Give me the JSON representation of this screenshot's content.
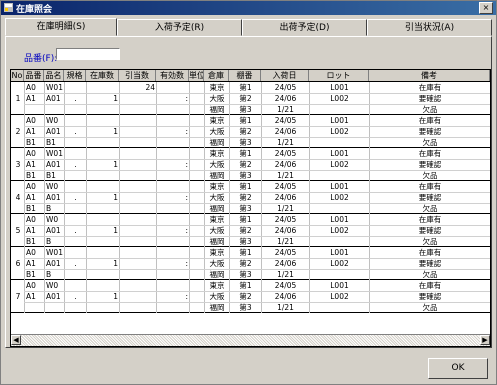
{
  "window": {
    "title": "在庫照会"
  },
  "tabs": [
    {
      "label": "在庫明細(S)"
    },
    {
      "label": "入荷予定(R)"
    },
    {
      "label": "出荷予定(D)"
    },
    {
      "label": "引当状況(A)"
    }
  ],
  "filter": {
    "label": "品番(F):",
    "value": ""
  },
  "columns": [
    "No",
    "品番",
    "品名",
    "規格",
    "在庫数",
    "引当数",
    "有効数",
    "単位",
    "倉庫",
    "棚番",
    "入荷日",
    "ロット",
    "備考"
  ],
  "records": [
    {
      "no": "1",
      "code": [
        "A0",
        "A1",
        ""
      ],
      "name": [
        "W01",
        "A01",
        ""
      ],
      "spec": ".",
      "stock": "1",
      "alloc": "24",
      "avail": ":",
      "unit": "",
      "wh": [
        "東京",
        "大阪",
        "福岡"
      ],
      "shelf": [
        "第1",
        "第2",
        "第3"
      ],
      "date": [
        "24/05",
        "24/06",
        "1/21"
      ],
      "lot": [
        "L001",
        "L002",
        ""
      ],
      "note": [
        "在庫有",
        "要確認",
        "欠品"
      ]
    },
    {
      "no": "2",
      "code": [
        "A0",
        "A1",
        "B1"
      ],
      "name": [
        "W0",
        "A01",
        "B1"
      ],
      "spec": ".",
      "stock": "1",
      "alloc": "",
      "avail": ":",
      "unit": "",
      "wh": [
        "東京",
        "大阪",
        "福岡"
      ],
      "shelf": [
        "第1",
        "第2",
        "第3"
      ],
      "date": [
        "24/05",
        "24/06",
        "1/21"
      ],
      "lot": [
        "L001",
        "L002",
        ""
      ],
      "note": [
        "在庫有",
        "要確認",
        "欠品"
      ]
    },
    {
      "no": "3",
      "code": [
        "A0",
        "A1",
        "B1"
      ],
      "name": [
        "W01",
        "A01",
        "B1"
      ],
      "spec": ".",
      "stock": "1",
      "alloc": "",
      "avail": ":",
      "unit": "",
      "wh": [
        "東京",
        "大阪",
        "福岡"
      ],
      "shelf": [
        "第1",
        "第2",
        "第3"
      ],
      "date": [
        "24/05",
        "24/06",
        "1/21"
      ],
      "lot": [
        "L001",
        "L002",
        ""
      ],
      "note": [
        "在庫有",
        "要確認",
        "欠品"
      ]
    },
    {
      "no": "4",
      "code": [
        "A0",
        "A1",
        "B1"
      ],
      "name": [
        "W0",
        "A01",
        "B"
      ],
      "spec": ".",
      "stock": "1",
      "alloc": "",
      "avail": ":",
      "unit": "",
      "wh": [
        "東京",
        "大阪",
        "福岡"
      ],
      "shelf": [
        "第1",
        "第2",
        "第3"
      ],
      "date": [
        "24/05",
        "24/06",
        "1/21"
      ],
      "lot": [
        "L001",
        "L002",
        ""
      ],
      "note": [
        "在庫有",
        "要確認",
        "欠品"
      ]
    },
    {
      "no": "5",
      "code": [
        "A0",
        "A1",
        "B1"
      ],
      "name": [
        "W0",
        "A01",
        "B"
      ],
      "spec": ".",
      "stock": "1",
      "alloc": "",
      "avail": ":",
      "unit": "",
      "wh": [
        "東京",
        "大阪",
        "福岡"
      ],
      "shelf": [
        "第1",
        "第2",
        "第3"
      ],
      "date": [
        "24/05",
        "24/06",
        "1/21"
      ],
      "lot": [
        "L001",
        "L002",
        ""
      ],
      "note": [
        "在庫有",
        "要確認",
        "欠品"
      ]
    },
    {
      "no": "6",
      "code": [
        "A0",
        "A1",
        "B1"
      ],
      "name": [
        "W01",
        "A01",
        "B"
      ],
      "spec": ".",
      "stock": "1",
      "alloc": "",
      "avail": ":",
      "unit": "",
      "wh": [
        "東京",
        "大阪",
        "福岡"
      ],
      "shelf": [
        "第1",
        "第2",
        "第3"
      ],
      "date": [
        "24/05",
        "24/06",
        "1/21"
      ],
      "lot": [
        "L001",
        "L002",
        ""
      ],
      "note": [
        "在庫有",
        "要確認",
        "欠品"
      ]
    },
    {
      "no": "7",
      "code": [
        "A0",
        "A1",
        ""
      ],
      "name": [
        "W0",
        "A01",
        ""
      ],
      "spec": ".",
      "stock": "1",
      "alloc": "",
      "avail": ":",
      "unit": "",
      "wh": [
        "東京",
        "大阪",
        "福岡"
      ],
      "shelf": [
        "第1",
        "第2",
        "第3"
      ],
      "date": [
        "24/05",
        "24/06",
        "1/21"
      ],
      "lot": [
        "L001",
        "L002",
        ""
      ],
      "note": [
        "在庫有",
        "要確認",
        "欠品"
      ]
    }
  ],
  "ok_button": {
    "label": "OK"
  }
}
